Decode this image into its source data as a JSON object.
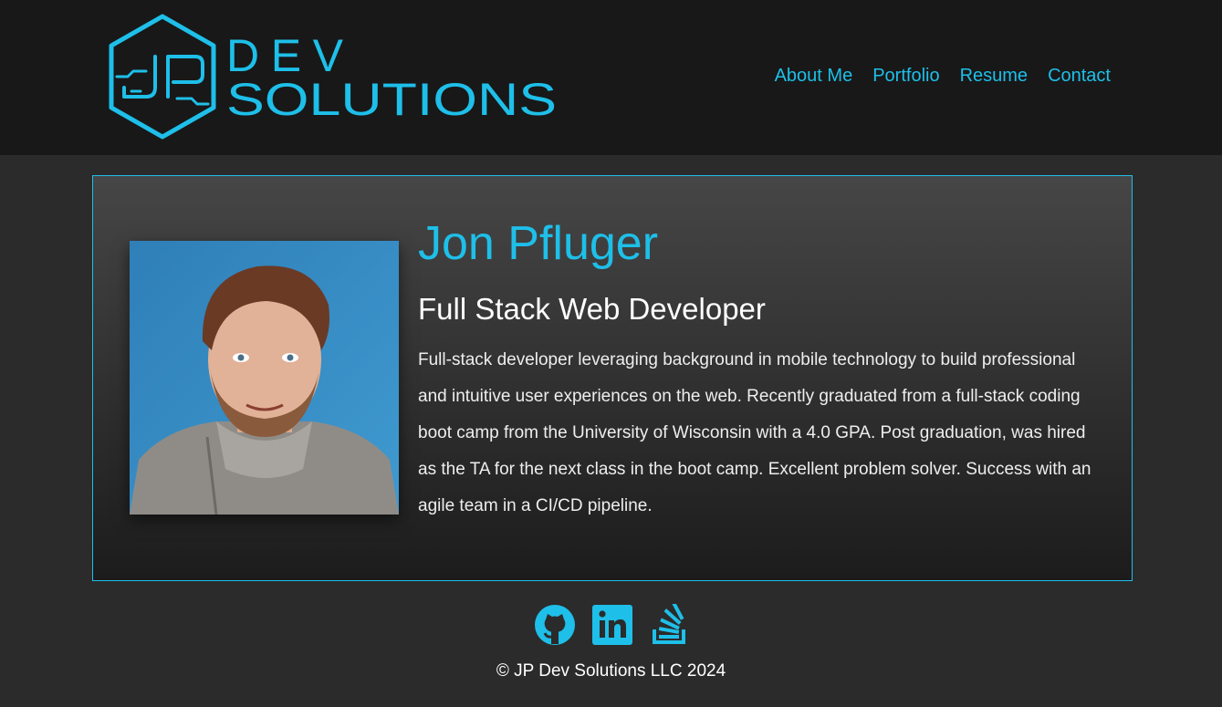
{
  "brand": {
    "logo_monogram": "JP",
    "logo_line1": "DEV",
    "logo_line2": "SOLUTIONS",
    "accent_color": "#1ebfe9"
  },
  "nav": {
    "items": [
      {
        "label": "About Me"
      },
      {
        "label": "Portfolio"
      },
      {
        "label": "Resume"
      },
      {
        "label": "Contact"
      }
    ]
  },
  "profile": {
    "name": "Jon Pfluger",
    "title": "Full Stack Web Developer",
    "bio": "Full-stack developer leveraging background in mobile technology to build professional and intuitive user experiences on the web. Recently graduated from a full-stack coding boot camp from the University of Wisconsin with a 4.0 GPA. Post graduation, was hired as the TA for the next class in the boot camp. Excellent problem solver. Success with an agile team in a CI/CD pipeline."
  },
  "social": {
    "icons": [
      "github-icon",
      "linkedin-icon",
      "stackoverflow-icon"
    ]
  },
  "footer": {
    "copyright": "© JP Dev Solutions LLC 2024"
  }
}
